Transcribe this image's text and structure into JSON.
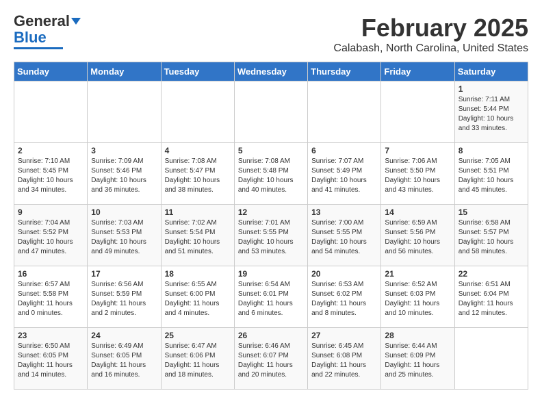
{
  "header": {
    "logo_general": "General",
    "logo_blue": "Blue",
    "month": "February 2025",
    "location": "Calabash, North Carolina, United States"
  },
  "weekdays": [
    "Sunday",
    "Monday",
    "Tuesday",
    "Wednesday",
    "Thursday",
    "Friday",
    "Saturday"
  ],
  "weeks": [
    [
      {
        "day": "",
        "info": ""
      },
      {
        "day": "",
        "info": ""
      },
      {
        "day": "",
        "info": ""
      },
      {
        "day": "",
        "info": ""
      },
      {
        "day": "",
        "info": ""
      },
      {
        "day": "",
        "info": ""
      },
      {
        "day": "1",
        "info": "Sunrise: 7:11 AM\nSunset: 5:44 PM\nDaylight: 10 hours and 33 minutes."
      }
    ],
    [
      {
        "day": "2",
        "info": "Sunrise: 7:10 AM\nSunset: 5:45 PM\nDaylight: 10 hours and 34 minutes."
      },
      {
        "day": "3",
        "info": "Sunrise: 7:09 AM\nSunset: 5:46 PM\nDaylight: 10 hours and 36 minutes."
      },
      {
        "day": "4",
        "info": "Sunrise: 7:08 AM\nSunset: 5:47 PM\nDaylight: 10 hours and 38 minutes."
      },
      {
        "day": "5",
        "info": "Sunrise: 7:08 AM\nSunset: 5:48 PM\nDaylight: 10 hours and 40 minutes."
      },
      {
        "day": "6",
        "info": "Sunrise: 7:07 AM\nSunset: 5:49 PM\nDaylight: 10 hours and 41 minutes."
      },
      {
        "day": "7",
        "info": "Sunrise: 7:06 AM\nSunset: 5:50 PM\nDaylight: 10 hours and 43 minutes."
      },
      {
        "day": "8",
        "info": "Sunrise: 7:05 AM\nSunset: 5:51 PM\nDaylight: 10 hours and 45 minutes."
      }
    ],
    [
      {
        "day": "9",
        "info": "Sunrise: 7:04 AM\nSunset: 5:52 PM\nDaylight: 10 hours and 47 minutes."
      },
      {
        "day": "10",
        "info": "Sunrise: 7:03 AM\nSunset: 5:53 PM\nDaylight: 10 hours and 49 minutes."
      },
      {
        "day": "11",
        "info": "Sunrise: 7:02 AM\nSunset: 5:54 PM\nDaylight: 10 hours and 51 minutes."
      },
      {
        "day": "12",
        "info": "Sunrise: 7:01 AM\nSunset: 5:55 PM\nDaylight: 10 hours and 53 minutes."
      },
      {
        "day": "13",
        "info": "Sunrise: 7:00 AM\nSunset: 5:55 PM\nDaylight: 10 hours and 54 minutes."
      },
      {
        "day": "14",
        "info": "Sunrise: 6:59 AM\nSunset: 5:56 PM\nDaylight: 10 hours and 56 minutes."
      },
      {
        "day": "15",
        "info": "Sunrise: 6:58 AM\nSunset: 5:57 PM\nDaylight: 10 hours and 58 minutes."
      }
    ],
    [
      {
        "day": "16",
        "info": "Sunrise: 6:57 AM\nSunset: 5:58 PM\nDaylight: 11 hours and 0 minutes."
      },
      {
        "day": "17",
        "info": "Sunrise: 6:56 AM\nSunset: 5:59 PM\nDaylight: 11 hours and 2 minutes."
      },
      {
        "day": "18",
        "info": "Sunrise: 6:55 AM\nSunset: 6:00 PM\nDaylight: 11 hours and 4 minutes."
      },
      {
        "day": "19",
        "info": "Sunrise: 6:54 AM\nSunset: 6:01 PM\nDaylight: 11 hours and 6 minutes."
      },
      {
        "day": "20",
        "info": "Sunrise: 6:53 AM\nSunset: 6:02 PM\nDaylight: 11 hours and 8 minutes."
      },
      {
        "day": "21",
        "info": "Sunrise: 6:52 AM\nSunset: 6:03 PM\nDaylight: 11 hours and 10 minutes."
      },
      {
        "day": "22",
        "info": "Sunrise: 6:51 AM\nSunset: 6:04 PM\nDaylight: 11 hours and 12 minutes."
      }
    ],
    [
      {
        "day": "23",
        "info": "Sunrise: 6:50 AM\nSunset: 6:05 PM\nDaylight: 11 hours and 14 minutes."
      },
      {
        "day": "24",
        "info": "Sunrise: 6:49 AM\nSunset: 6:05 PM\nDaylight: 11 hours and 16 minutes."
      },
      {
        "day": "25",
        "info": "Sunrise: 6:47 AM\nSunset: 6:06 PM\nDaylight: 11 hours and 18 minutes."
      },
      {
        "day": "26",
        "info": "Sunrise: 6:46 AM\nSunset: 6:07 PM\nDaylight: 11 hours and 20 minutes."
      },
      {
        "day": "27",
        "info": "Sunrise: 6:45 AM\nSunset: 6:08 PM\nDaylight: 11 hours and 22 minutes."
      },
      {
        "day": "28",
        "info": "Sunrise: 6:44 AM\nSunset: 6:09 PM\nDaylight: 11 hours and 25 minutes."
      },
      {
        "day": "",
        "info": ""
      }
    ]
  ]
}
